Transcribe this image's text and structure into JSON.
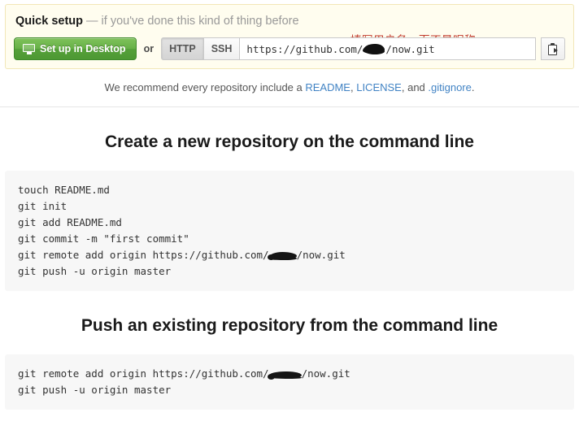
{
  "quick_setup": {
    "title": "Quick setup",
    "subtitle": "— if you've done this kind of thing before",
    "annotation": "填写用户名，而不是昵称",
    "annotation_color": "#c0392b",
    "desktop_button": "Set up in Desktop",
    "desktop_button_color": "#56a13a",
    "or_label": "or",
    "protocols": [
      {
        "label": "HTTP",
        "selected": true
      },
      {
        "label": "SSH",
        "selected": false
      }
    ],
    "clone_url": {
      "prefix": "https://github.com/",
      "redacted": true,
      "suffix": "/now.git"
    },
    "copy_icon": "clipboard-icon",
    "panel_background": "#fffdef"
  },
  "recommend": {
    "prefix": "We recommend every repository include a ",
    "link_readme": "README",
    "sep1": ", ",
    "link_license": "LICENSE",
    "sep2": ", and ",
    "link_gitignore": ".gitignore",
    "suffix": ".",
    "link_color": "#4183c4"
  },
  "sections": [
    {
      "title": "Create a new repository on the command line",
      "lines": [
        {
          "text": "touch README.md"
        },
        {
          "text": "git init"
        },
        {
          "text": "git add README.md"
        },
        {
          "text": "git commit -m \"first commit\""
        },
        {
          "prefix": "git remote add origin https://github.com/",
          "redacted": true,
          "suffix": "/now.git"
        },
        {
          "text": "git push -u origin master"
        }
      ]
    },
    {
      "title": "Push an existing repository from the command line",
      "lines": [
        {
          "prefix": "git remote add origin https://github.com/",
          "redacted": true,
          "suffix": "/now.git"
        },
        {
          "text": "git push -u origin master"
        }
      ]
    }
  ]
}
